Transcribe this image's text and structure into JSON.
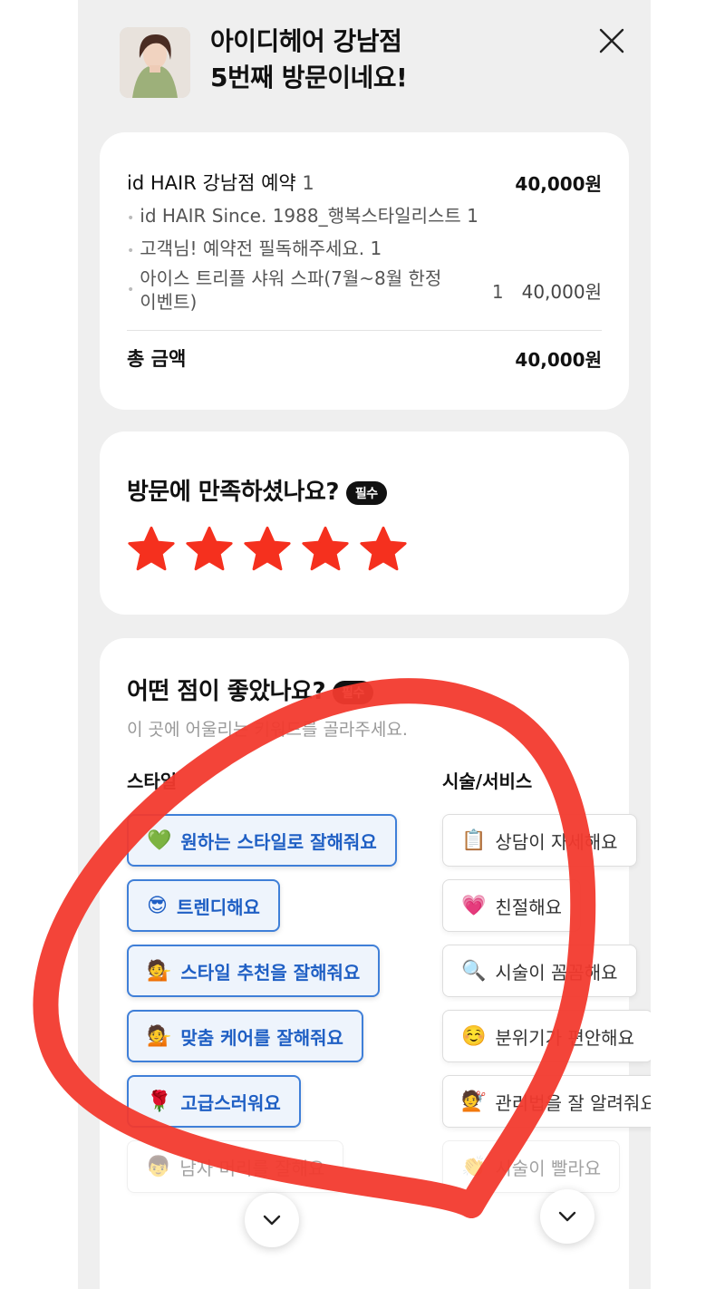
{
  "header": {
    "title_line1": "아이디헤어 강남점",
    "title_line2": "5번째 방문이네요!",
    "close_icon": "close-icon"
  },
  "order": {
    "items": [
      {
        "name": "id HAIR 강남점 예약",
        "qty": "1",
        "price": "40,000원"
      },
      {
        "name": "id HAIR Since. 1988_행복스타일리스트",
        "qty": "1"
      },
      {
        "name": "고객님! 예약전 필독해주세요.",
        "qty": "1"
      },
      {
        "name_line1": "아이스 트리플 샤워 스파(7월~8월 한정",
        "name_line2": "이벤트)",
        "qty": "1",
        "price": "40,000원"
      }
    ],
    "total_label": "총 금액",
    "total_value": "40,000원"
  },
  "rating": {
    "question": "방문에 만족하셨나요?",
    "required_badge": "필수",
    "stars": 5,
    "star_color": "#f5301e"
  },
  "good_points": {
    "question": "어떤 점이 좋았나요?",
    "helper": "이 곳에 어울리는 키워드를 골라주세요.",
    "style_column_label": "스타일",
    "service_column_label": "시술/서비스",
    "style_chips": [
      {
        "emoji": "💚",
        "label": "원하는 스타일로 잘해줘요",
        "selected": true
      },
      {
        "emoji": "😎",
        "label": "트렌디해요",
        "selected": true
      },
      {
        "emoji": "💁",
        "label": "스타일 추천을 잘해줘요",
        "selected": true
      },
      {
        "emoji": "💁",
        "label": "맞춤 케어를 잘해줘요",
        "selected": true
      },
      {
        "emoji": "🌹",
        "label": "고급스러워요",
        "selected": true
      },
      {
        "emoji": "👦",
        "label": "남자 머리를 잘해요",
        "selected": false
      }
    ],
    "service_chips": [
      {
        "emoji": "📋",
        "label": "상담이 자세해요",
        "selected": false
      },
      {
        "emoji": "💗",
        "label": "친절해요",
        "selected": false
      },
      {
        "emoji": "🔍",
        "label": "시술이 꼼꼼해요",
        "selected": false
      },
      {
        "emoji": "☺️",
        "label": "분위기가 편안해요",
        "selected": false
      },
      {
        "emoji": "💇",
        "label": "관리법을 잘 알려줘요",
        "selected": false
      },
      {
        "emoji": "👏",
        "label": "시술이 빨라요",
        "selected": false
      }
    ],
    "accent_color": "#3f7fd8"
  },
  "annotation": {
    "color": "#f23a2e"
  }
}
